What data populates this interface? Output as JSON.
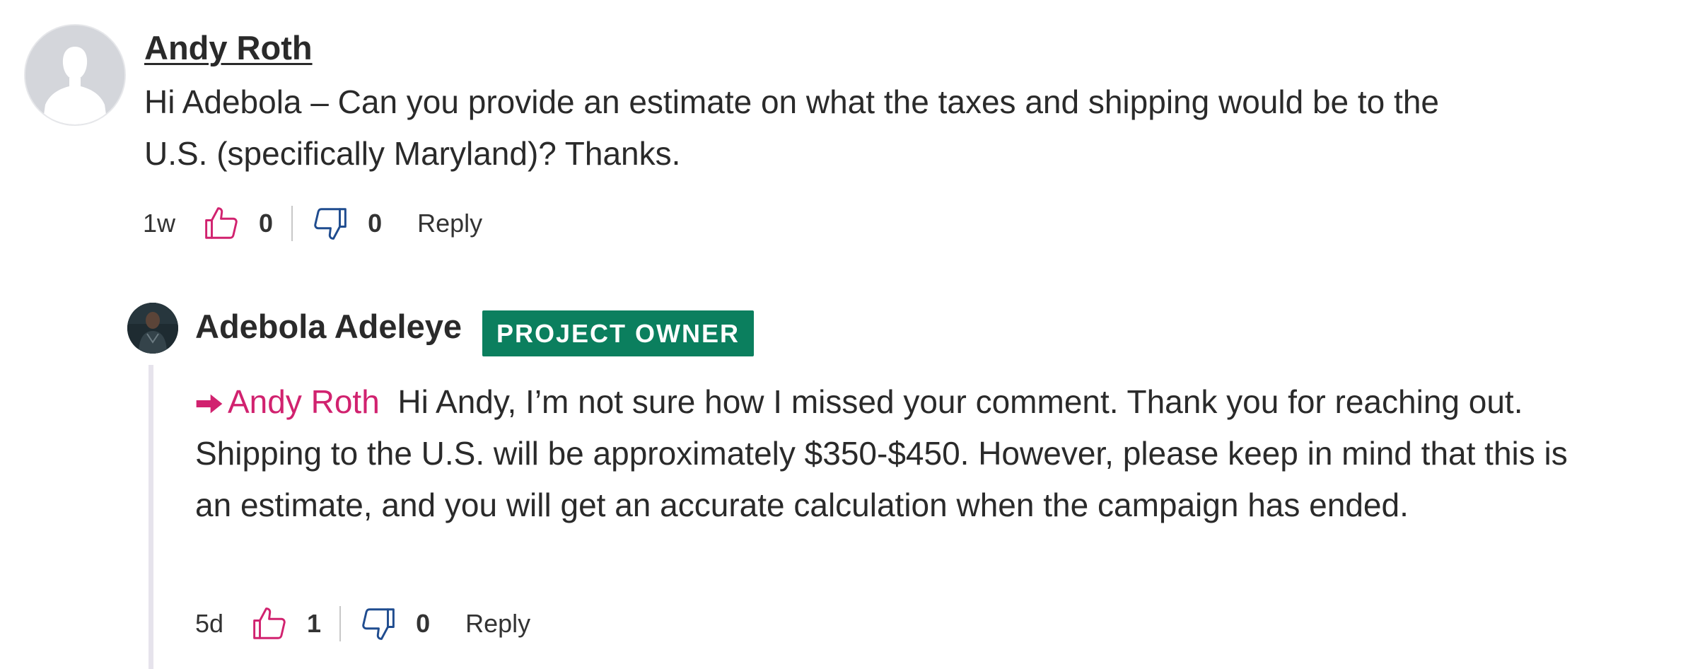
{
  "comments": [
    {
      "author": "Andy Roth",
      "body": "Hi Adebola – Can you provide an estimate on what the taxes and shipping would be to the U.S. (specifically Maryland)? Thanks.",
      "time": "1w",
      "likes": "0",
      "dislikes": "0",
      "reply_label": "Reply",
      "replies": [
        {
          "author": "Adebola Adeleye",
          "badge": "PROJECT OWNER",
          "mention": "Andy Roth",
          "body": "Hi Andy, I’m not sure how I missed your comment. Thank you for reaching out. Shipping to the U.S. will be approximately $350-$450. However, please keep in mind that this is an estimate, and you will get an accurate calculation when the campaign has ended.",
          "time": "5d",
          "likes": "1",
          "dislikes": "0",
          "reply_label": "Reply"
        }
      ]
    }
  ],
  "colors": {
    "accent": "#d1226f",
    "badge_bg": "#0b7f5e",
    "dislike_icon": "#1f4c8f",
    "thread_line": "#e6e3ec"
  },
  "icons": {
    "like": "thumbs-up-icon",
    "dislike": "thumbs-down-icon",
    "mention_arrow": "arrow-right-icon",
    "default_avatar": "user-silhouette-icon"
  }
}
